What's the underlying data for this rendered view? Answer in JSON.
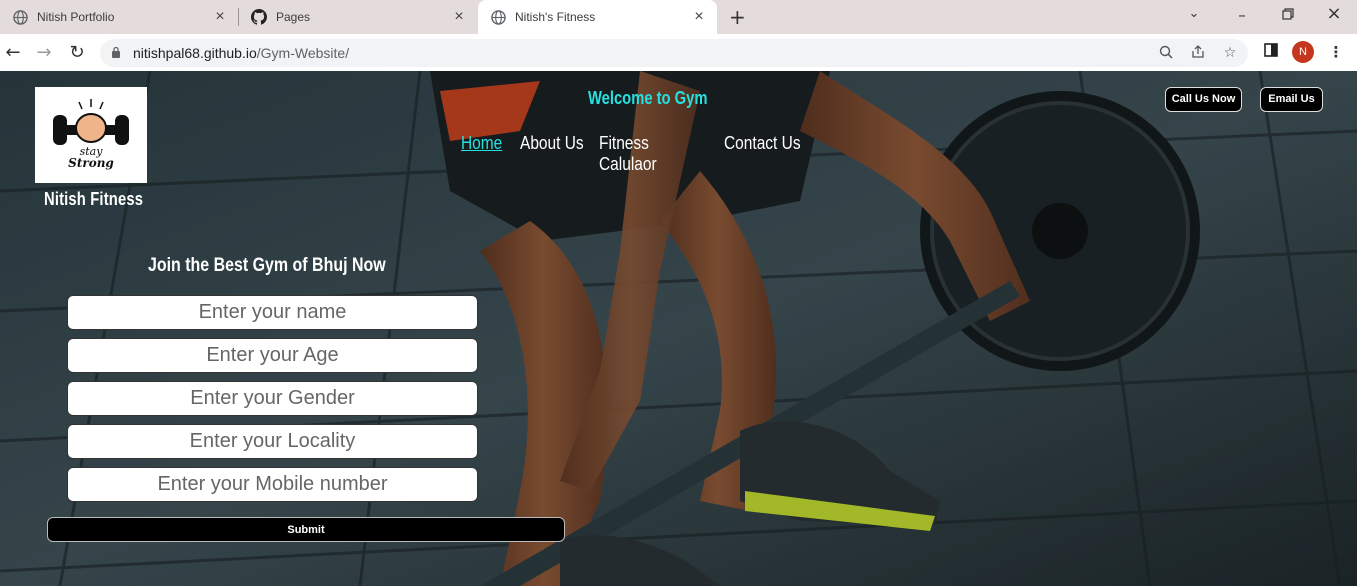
{
  "browser": {
    "tabs": [
      {
        "title": "Nitish Portfolio",
        "icon": "globe-icon"
      },
      {
        "title": "Pages",
        "icon": "github-icon"
      },
      {
        "title": "Nitish's Fitness",
        "icon": "globe-icon",
        "active": true
      }
    ],
    "url_host": "nitishpal68.github.io",
    "url_path": "/Gym-Website/",
    "profile_initial": "N"
  },
  "site": {
    "logo_text_1": "stay",
    "logo_text_2": "Strong",
    "brand": "Nitish Fitness",
    "welcome": "Welcome to Gym",
    "nav": [
      "Home",
      "About Us",
      "Fitness Calulaor",
      "Contact Us"
    ],
    "call_button": "Call Us Now",
    "email_button": "Email Us"
  },
  "form": {
    "title": "Join the Best Gym of Bhuj Now",
    "fields": [
      {
        "placeholder": "Enter your name"
      },
      {
        "placeholder": "Enter your Age"
      },
      {
        "placeholder": "Enter your Gender"
      },
      {
        "placeholder": "Enter your Locality"
      },
      {
        "placeholder": "Enter your Mobile number"
      }
    ],
    "submit_label": "Submit"
  },
  "colors": {
    "accent": "#26e0e0",
    "tabbar": "#e4dcda",
    "avatar": "#c4361d"
  }
}
